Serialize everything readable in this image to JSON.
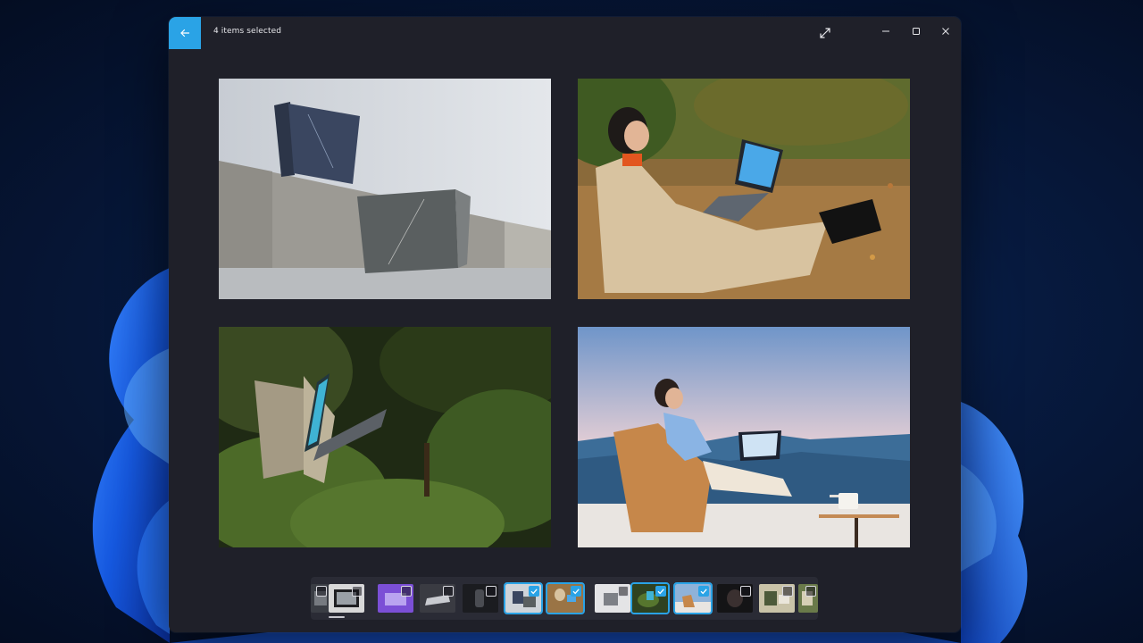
{
  "window": {
    "title": "4 items selected",
    "accent": "#2aa3e6",
    "background": "#1f2029"
  },
  "icons": {
    "back": "arrow-left-icon",
    "expand": "expand-icon",
    "minimize": "minimize-icon",
    "maximize": "maximize-icon",
    "close": "close-icon",
    "check": "checkmark-icon"
  },
  "photos": [
    {
      "name": "laptops-on-concrete-wall"
    },
    {
      "name": "woman-laptop-autumn-leaves"
    },
    {
      "name": "laptop-in-forest"
    },
    {
      "name": "woman-laptop-mountain-terrace"
    }
  ],
  "filmstrip": {
    "thumbnails": [
      {
        "id": 1,
        "selected": false
      },
      {
        "id": 2,
        "selected": false
      },
      {
        "id": 3,
        "selected": false
      },
      {
        "id": 4,
        "selected": false
      },
      {
        "id": 5,
        "selected": false
      },
      {
        "id": 6,
        "selected": true
      },
      {
        "id": 7,
        "selected": true
      },
      {
        "id": 8,
        "selected": false
      },
      {
        "id": 9,
        "selected": true
      },
      {
        "id": 10,
        "selected": true
      },
      {
        "id": 11,
        "selected": false
      },
      {
        "id": 12,
        "selected": false
      },
      {
        "id": 13,
        "selected": false
      }
    ]
  }
}
